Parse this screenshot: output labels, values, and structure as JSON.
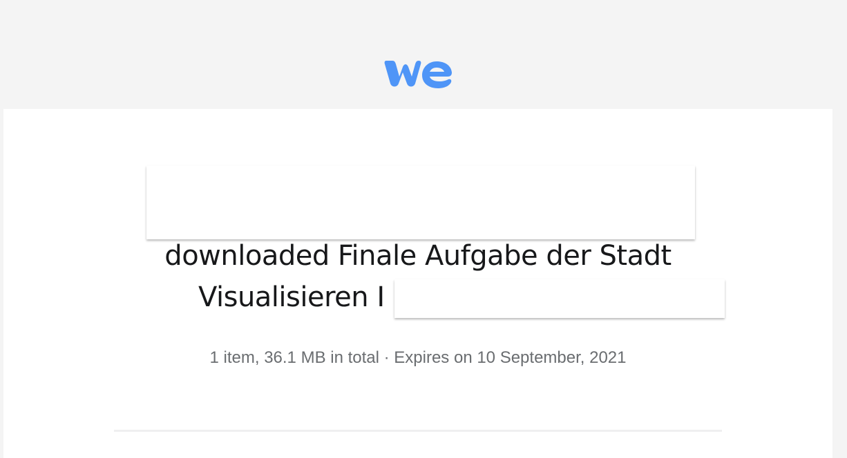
{
  "brand": {
    "logo_icon": "wetransfer-logo-icon",
    "accent_color": "#4f95f7"
  },
  "transfer": {
    "title_line_1": "downloaded Finale Aufgabe der Stadt",
    "title_line_2": "Visualisieren I",
    "details": "1 item, 36.1 MB in total · Expires on 10 September, 2021"
  }
}
